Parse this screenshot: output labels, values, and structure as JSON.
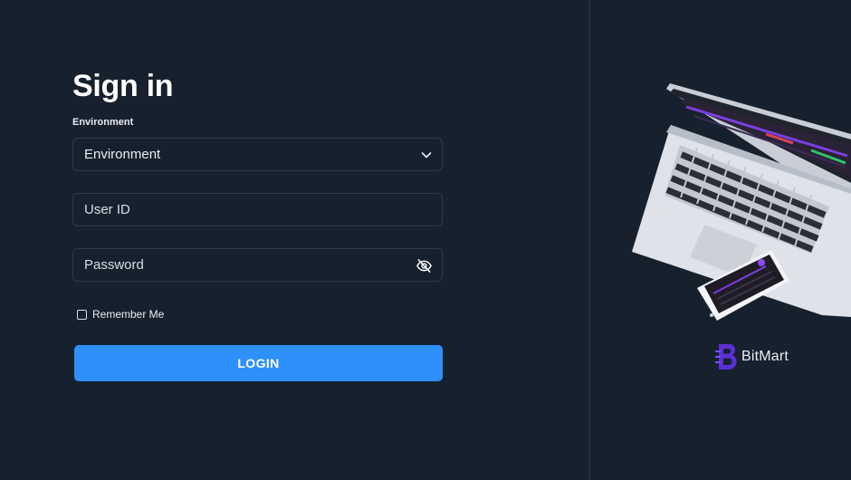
{
  "form": {
    "title": "Sign in",
    "environment_label": "Environment",
    "environment_value": "Environment",
    "user_id_placeholder": "User ID",
    "password_placeholder": "Password",
    "remember_label": "Remember Me",
    "remember_checked": false,
    "login_label": "LOGIN"
  },
  "brand": {
    "name": "BitMart",
    "logo_icon": "bitmart-logo-icon"
  },
  "icons": {
    "select_chevron": "chevron-down-icon",
    "password_toggle": "eye-off-icon"
  },
  "colors": {
    "background": "#17212e",
    "accent": "#2e90fa",
    "brand_purple": "#6b3ce6"
  }
}
